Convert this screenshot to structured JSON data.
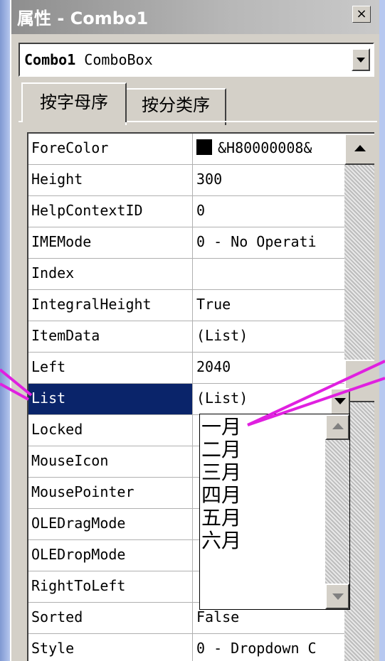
{
  "window": {
    "title": "属性 - Combo1",
    "close": "×"
  },
  "object_combo": {
    "name": "Combo1",
    "type": "ComboBox"
  },
  "tabs": [
    {
      "label": "按字母序",
      "active": true
    },
    {
      "label": "按分类序",
      "active": false
    }
  ],
  "properties": [
    {
      "name": "ForeColor",
      "value": "&H80000008&",
      "swatch": "#000000"
    },
    {
      "name": "Height",
      "value": "300"
    },
    {
      "name": "HelpContextID",
      "value": "0"
    },
    {
      "name": "IMEMode",
      "value": "0 - No Operati"
    },
    {
      "name": "Index",
      "value": ""
    },
    {
      "name": "IntegralHeight",
      "value": "True"
    },
    {
      "name": "ItemData",
      "value": "(List)"
    },
    {
      "name": "Left",
      "value": "2040"
    },
    {
      "name": "List",
      "value": "(List)",
      "selected": true
    },
    {
      "name": "Locked",
      "value": ""
    },
    {
      "name": "MouseIcon",
      "value": ""
    },
    {
      "name": "MousePointer",
      "value": ""
    },
    {
      "name": "OLEDragMode",
      "value": ""
    },
    {
      "name": "OLEDropMode",
      "value": ""
    },
    {
      "name": "RightToLeft",
      "value": ""
    },
    {
      "name": "Sorted",
      "value": "False"
    },
    {
      "name": "Style",
      "value": "0 - Dropdown C"
    }
  ],
  "list_dropdown": {
    "items": [
      "一月",
      "二月",
      "三月",
      "四月",
      "五月",
      "六月"
    ]
  },
  "colors": {
    "selection": "#0a246a",
    "annotation": "#e020e0",
    "panel": "#d4d0c8"
  }
}
